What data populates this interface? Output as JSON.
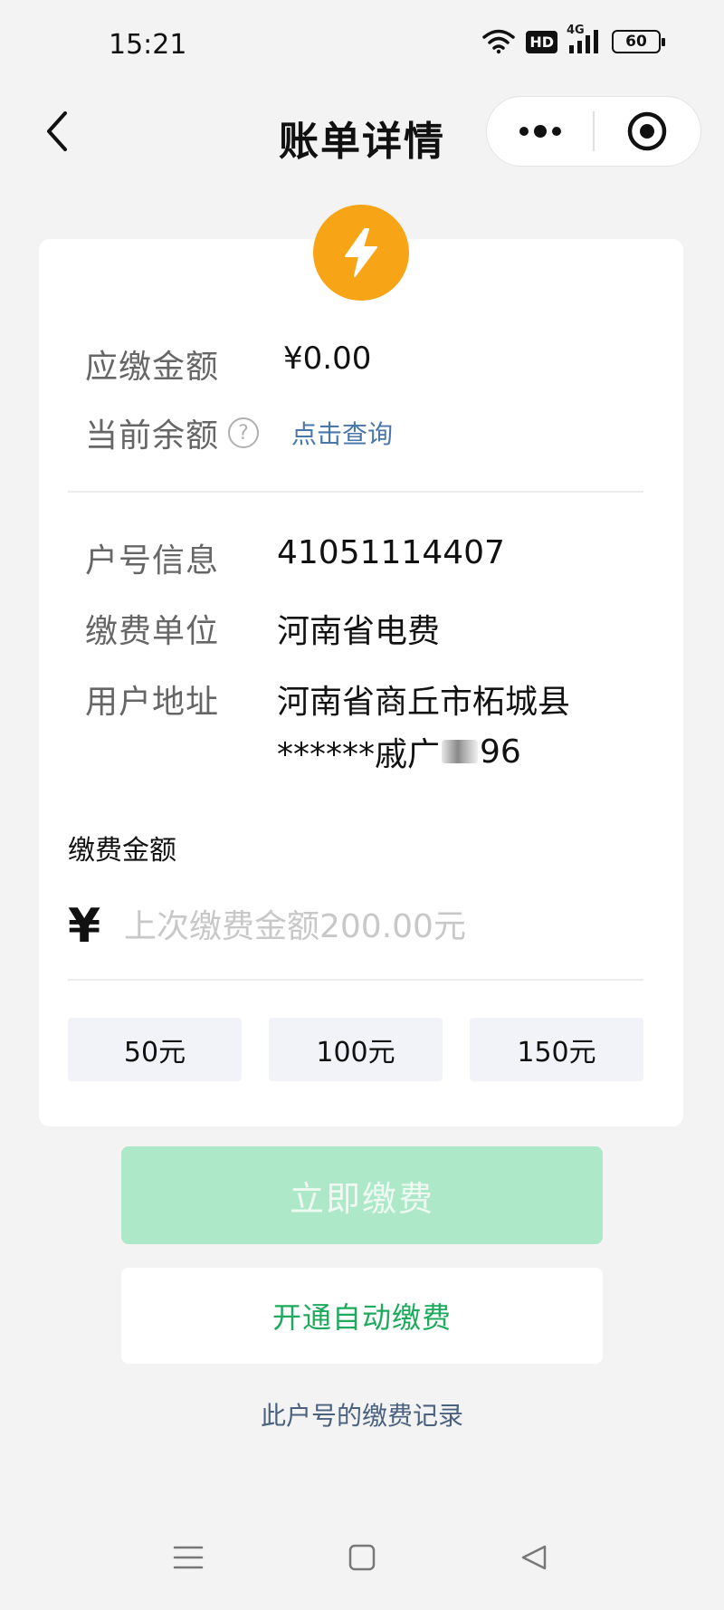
{
  "status_bar": {
    "time": "15:21",
    "hd": "HD",
    "network": "4G",
    "battery": "60"
  },
  "nav": {
    "title": "账单详情",
    "icons": [
      "back-icon",
      "more-icon",
      "close-mini-program-icon"
    ]
  },
  "bill": {
    "due_label": "应缴金额",
    "due_value": "¥0.00",
    "balance_label": "当前余额",
    "balance_link": "点击查询"
  },
  "account": {
    "id_label": "户号信息",
    "id_value": "41051114407",
    "unit_label": "缴费单位",
    "unit_value": "河南省电费",
    "addr_label": "用户地址",
    "addr_line1": "河南省商丘市柘城县",
    "addr_line2": "******戚广",
    "addr_line2_end": "96"
  },
  "payment": {
    "section_label": "缴费金额",
    "currency": "¥",
    "amount_placeholder": "上次缴费金额200.00元",
    "quick_amounts": [
      "50元",
      "100元",
      "150元"
    ]
  },
  "actions": {
    "pay_now": "立即缴费",
    "auto_pay": "开通自动缴费",
    "records": "此户号的缴费记录"
  },
  "colors": {
    "bolt_badge": "#f7a517",
    "pay_button_disabled": "#ade8c8",
    "auto_pay_text": "#1eaa5c",
    "link": "#4a76a8"
  }
}
